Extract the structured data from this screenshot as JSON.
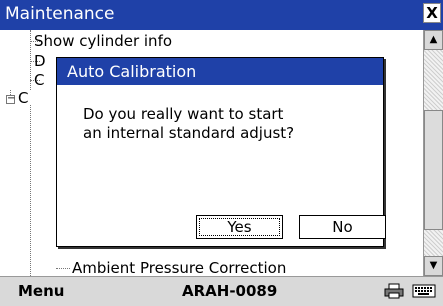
{
  "window": {
    "title": "Maintenance",
    "close_label": "X"
  },
  "tree": {
    "items": [
      {
        "label": "Show cylinder info"
      },
      {
        "label": "D"
      },
      {
        "label": "C"
      },
      {
        "label": "C",
        "expander": "−"
      },
      {
        "label": "Ambient Pressure Correction"
      }
    ]
  },
  "dialog": {
    "title": "Auto Calibration",
    "message_line1": "Do you really want to start",
    "message_line2": "an internal standard adjust?",
    "yes_label": "Yes",
    "no_label": "No"
  },
  "bottom_bar": {
    "menu_label": "Menu",
    "device_label": "ARAH-0089",
    "printer_icon": "printer-icon",
    "keyboard_icon": "keyboard-icon"
  },
  "colors": {
    "title_bar": "#1f41a8",
    "bottom_bar": "#d9d9d9"
  }
}
